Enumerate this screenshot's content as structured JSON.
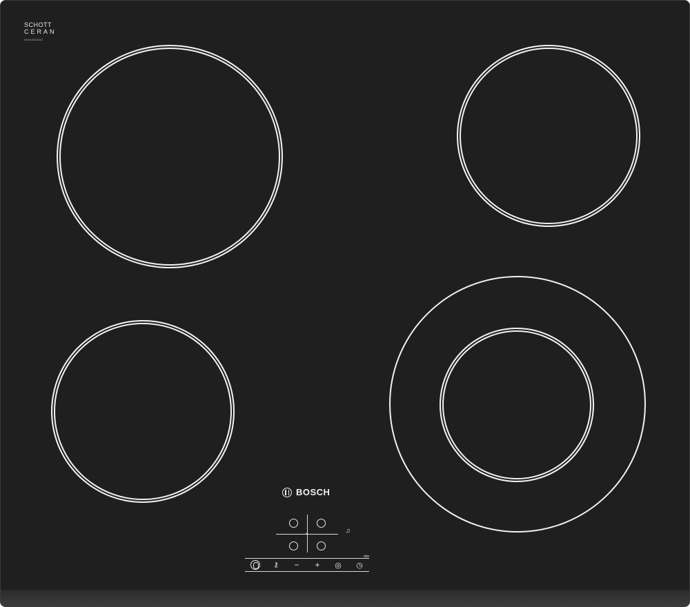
{
  "panel_branding": {
    "schott_line1": "SCHOTT",
    "schott_line2": "CERAN",
    "serial_mark": "0000000000"
  },
  "brand": {
    "name": "BOSCH",
    "logo_icon": "bosch-armature-icon"
  },
  "zones": [
    {
      "id": "front-left",
      "type": "single"
    },
    {
      "id": "rear-left",
      "type": "single"
    },
    {
      "id": "rear-right",
      "type": "single"
    },
    {
      "id": "front-right",
      "type": "dual"
    }
  ],
  "control_panel": {
    "timer_label": "min",
    "buttons": {
      "power": "power-icon",
      "childlock": "key-icon",
      "minus": "−",
      "plus": "+",
      "dual_zone": "dual-ring-icon",
      "timer": "clock-icon",
      "alarm": "bell-icon"
    }
  },
  "colors": {
    "glass": "#1f1f1f",
    "print": "#f2f2f2"
  }
}
